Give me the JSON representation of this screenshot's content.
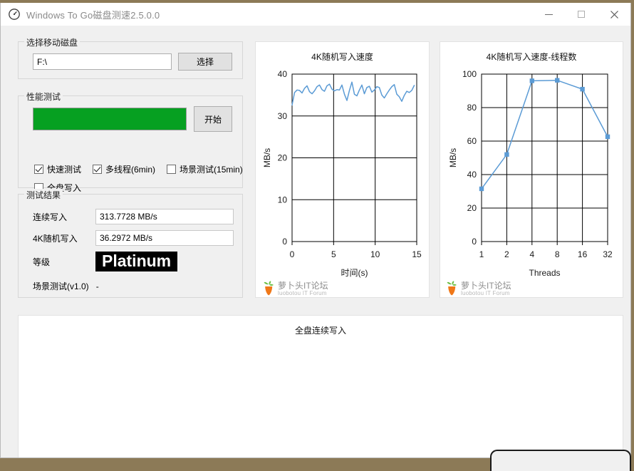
{
  "window": {
    "title": "Windows To Go磁盘测速2.5.0.0",
    "app_icon": "speedometer-icon",
    "controls": {
      "minimize": "—",
      "maximize": "□",
      "close": "✕"
    }
  },
  "disk_group": {
    "legend": "选择移动磁盘",
    "path_value": "F:\\",
    "path_placeholder": "",
    "select_button": "选择"
  },
  "perf_group": {
    "legend": "性能测试",
    "start_button": "开始",
    "progress_percent": 100,
    "progress_color": "#06A021",
    "checkboxes": [
      {
        "label": "快速测试",
        "checked": true
      },
      {
        "label": "多线程(6min)",
        "checked": true
      },
      {
        "label": "场景测试(15min)",
        "checked": false
      },
      {
        "label": "全盘写入",
        "checked": false
      }
    ]
  },
  "result_group": {
    "legend": "测试结果",
    "rows": [
      {
        "label": "连续写入",
        "value": "313.7728 MB/s"
      },
      {
        "label": "4K随机写入",
        "value": "36.2972 MB/s"
      }
    ],
    "grade_label": "等级",
    "grade_value": "Platinum",
    "scene_label": "场景测试(v1.0)",
    "scene_value": "-"
  },
  "watermark": {
    "cn": "萝卜头IT论坛",
    "en": "luobotou IT Forum",
    "icon": "carrot-icon"
  },
  "chart_data": [
    {
      "id": "chart1",
      "type": "line",
      "title": "4K随机写入速度",
      "xlabel": "时间(s)",
      "ylabel": "MB/s",
      "xlim": [
        0,
        15
      ],
      "ylim": [
        0,
        40
      ],
      "xticks": [
        0,
        5,
        10,
        15
      ],
      "yticks": [
        0,
        10,
        20,
        30,
        40
      ],
      "grid": true,
      "line_color": "#5B9BD5",
      "x": [
        0.0,
        0.3,
        0.6,
        0.9,
        1.2,
        1.5,
        1.8,
        2.1,
        2.4,
        2.7,
        3.0,
        3.3,
        3.6,
        3.9,
        4.2,
        4.5,
        4.8,
        5.1,
        5.4,
        5.7,
        6.0,
        6.3,
        6.6,
        6.9,
        7.2,
        7.5,
        7.8,
        8.1,
        8.4,
        8.7,
        9.0,
        9.3,
        9.6,
        9.9,
        10.2,
        10.5,
        10.8,
        11.1,
        11.4,
        11.7,
        12.0,
        12.3,
        12.6,
        12.9,
        13.2,
        13.5,
        13.8,
        14.1,
        14.4,
        14.7
      ],
      "y": [
        32.6,
        35.6,
        36.2,
        36.1,
        35.5,
        36.6,
        37.2,
        35.8,
        35.3,
        36.0,
        37.0,
        37.4,
        36.3,
        35.9,
        37.2,
        37.6,
        36.4,
        36.0,
        36.3,
        36.2,
        37.4,
        35.2,
        33.7,
        36.1,
        38.1,
        35.2,
        34.8,
        36.2,
        37.4,
        35.3,
        36.8,
        37.1,
        35.7,
        36.2,
        37.0,
        36.8,
        35.0,
        34.3,
        35.3,
        36.2,
        37.0,
        37.5,
        35.2,
        34.6,
        33.5,
        34.9,
        35.9,
        35.6,
        36.1,
        37.3
      ]
    },
    {
      "id": "chart2",
      "type": "line",
      "title": "4K随机写入速度-线程数",
      "xlabel": "Threads",
      "ylabel": "MB/s",
      "ylim": [
        0,
        100
      ],
      "yticks": [
        0,
        20,
        40,
        60,
        80,
        100
      ],
      "grid": true,
      "line_color": "#5B9BD5",
      "marker": "square",
      "categories": [
        "1",
        "2",
        "4",
        "8",
        "16",
        "32"
      ],
      "values": [
        31.5,
        52.0,
        96.0,
        96.3,
        91.0,
        62.6
      ]
    },
    {
      "id": "chart3",
      "type": "line",
      "title": "全盘连续写入",
      "xlabel": "",
      "ylabel": "",
      "grid": false,
      "x": [],
      "y": []
    }
  ]
}
